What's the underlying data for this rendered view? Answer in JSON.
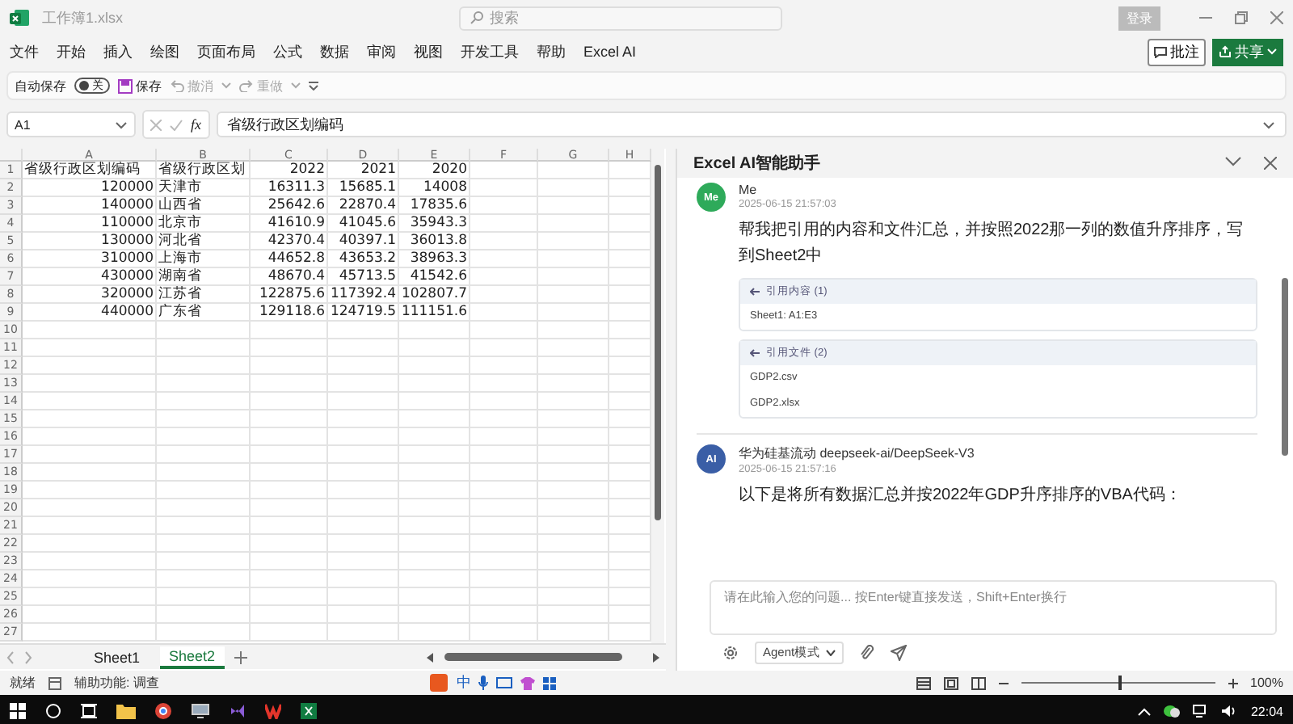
{
  "window": {
    "title": "工作簿1.xlsx",
    "search_placeholder": "搜索",
    "login": "登录"
  },
  "menu": [
    {
      "label": "文件"
    },
    {
      "label": "开始"
    },
    {
      "label": "插入"
    },
    {
      "label": "绘图"
    },
    {
      "label": "页面布局"
    },
    {
      "label": "公式"
    },
    {
      "label": "数据"
    },
    {
      "label": "审阅"
    },
    {
      "label": "视图"
    },
    {
      "label": "开发工具"
    },
    {
      "label": "帮助"
    },
    {
      "label": "Excel AI"
    }
  ],
  "ribbon_buttons": {
    "comments": "批注",
    "share": "共享"
  },
  "quick_access": {
    "autosave_label": "自动保存",
    "autosave": {
      "on": false,
      "label": "关"
    },
    "save": "保存",
    "undo": "撤消",
    "redo": "重做"
  },
  "formula_bar": {
    "name_box": "A1",
    "fx": "fx",
    "value": "省级行政区划编码"
  },
  "grid": {
    "columns": [
      "A",
      "B",
      "C",
      "D",
      "E",
      "F",
      "G",
      "H"
    ],
    "rows": [
      {
        "number": "1",
        "cells": [
          "省级行政区划编码",
          "省级行政区划",
          "2022",
          "2021",
          "2020"
        ]
      },
      {
        "number": "2",
        "cells": [
          "120000",
          "天津市",
          "16311.3",
          "15685.1",
          "14008"
        ]
      },
      {
        "number": "3",
        "cells": [
          "140000",
          "山西省",
          "25642.6",
          "22870.4",
          "17835.6"
        ]
      },
      {
        "number": "4",
        "cells": [
          "110000",
          "北京市",
          "41610.9",
          "41045.6",
          "35943.3"
        ]
      },
      {
        "number": "5",
        "cells": [
          "130000",
          "河北省",
          "42370.4",
          "40397.1",
          "36013.8"
        ]
      },
      {
        "number": "6",
        "cells": [
          "310000",
          "上海市",
          "44652.8",
          "43653.2",
          "38963.3"
        ]
      },
      {
        "number": "7",
        "cells": [
          "430000",
          "湖南省",
          "48670.4",
          "45713.5",
          "41542.6"
        ]
      },
      {
        "number": "8",
        "cells": [
          "320000",
          "江苏省",
          "122875.6",
          "117392.4",
          "102807.7"
        ]
      },
      {
        "number": "9",
        "cells": [
          "440000",
          "广东省",
          "129118.6",
          "124719.5",
          "111151.6"
        ]
      },
      {
        "number": "10"
      },
      {
        "number": "11"
      },
      {
        "number": "12"
      },
      {
        "number": "13"
      },
      {
        "number": "14"
      },
      {
        "number": "15"
      },
      {
        "number": "16"
      },
      {
        "number": "17"
      },
      {
        "number": "18"
      },
      {
        "number": "19"
      },
      {
        "number": "20"
      },
      {
        "number": "21"
      },
      {
        "number": "22"
      },
      {
        "number": "23"
      },
      {
        "number": "24"
      },
      {
        "number": "25"
      },
      {
        "number": "26"
      },
      {
        "number": "27"
      }
    ]
  },
  "sheet_tabs": [
    {
      "label": "Sheet1",
      "selected": false
    },
    {
      "label": "Sheet2",
      "selected": true
    }
  ],
  "ai_panel": {
    "title": "Excel AI智能助手",
    "messages": [
      {
        "kind": "user",
        "avatar": "Me",
        "author": "Me",
        "time": "2025-06-15 21:57:03",
        "text": "帮我把引用的内容和文件汇总，并按照2022那一列的数值升序排序，写到Sheet2中",
        "references": [
          {
            "title": "引用内容 (1)",
            "items": [
              "Sheet1: A1:E3"
            ]
          },
          {
            "title": "引用文件 (2)",
            "items": [
              "GDP2.csv",
              "GDP2.xlsx"
            ]
          }
        ]
      },
      {
        "kind": "ai",
        "avatar": "AI",
        "author": "华为硅基流动 deepseek-ai/DeepSeek-V3",
        "time": "2025-06-15 21:57:16",
        "text": "以下是将所有数据汇总并按2022年GDP升序排序的VBA代码："
      }
    ],
    "input_placeholder": "请在此输入您的问题... 按Enter键直接发送，Shift+Enter换行",
    "mode": "Agent模式"
  },
  "status_bar": {
    "ready": "就绪",
    "accessibility": "辅助功能: 调查",
    "ime_mode": "中",
    "zoom_slider": {
      "level": 0.5
    },
    "zoom": "100%"
  },
  "taskbar": {
    "time": "22:04"
  }
}
